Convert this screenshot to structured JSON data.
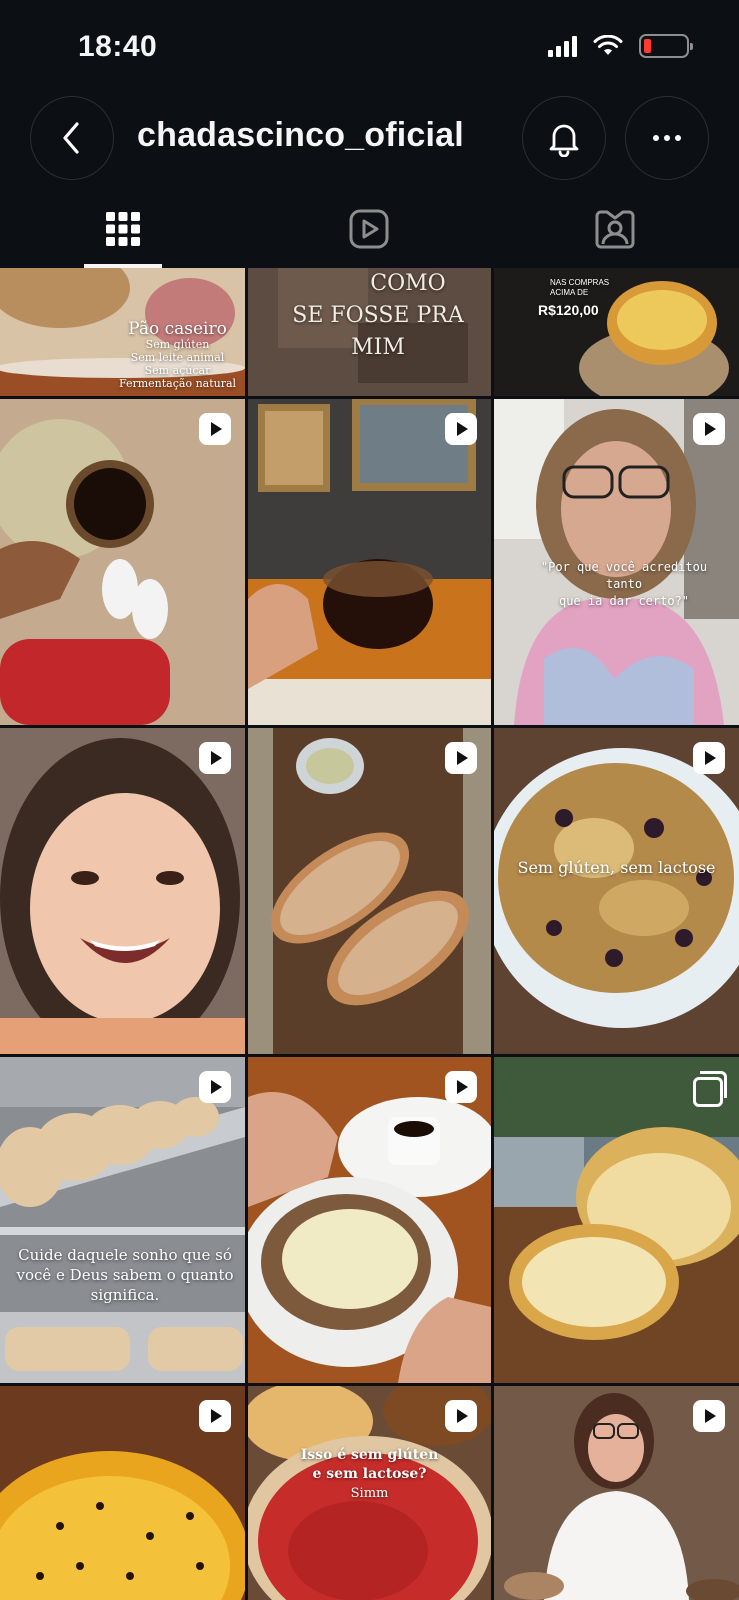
{
  "status_bar": {
    "time": "18:40"
  },
  "header": {
    "username": "chadascinco_oficial"
  },
  "tabs": [
    {
      "name": "grid",
      "active": true
    },
    {
      "name": "reels",
      "active": false
    },
    {
      "name": "tagged",
      "active": false
    }
  ],
  "posts": [
    {
      "type": "image",
      "text_lines": [
        "Pão caseiro",
        "Sem glúten",
        "Sem leite animal",
        "Sem açúcar",
        "Fermentação natural"
      ]
    },
    {
      "type": "image",
      "text_lines": [
        "COMO",
        "SE FOSSE PRA MIM"
      ]
    },
    {
      "type": "image",
      "text_lines": [
        "NAS COMPRAS ACIMA DE",
        "R$120,00"
      ]
    },
    {
      "type": "reel",
      "text_lines": []
    },
    {
      "type": "reel",
      "text_lines": []
    },
    {
      "type": "reel",
      "text_lines": [
        "\"Por que você acreditou tanto",
        "que ia dar certo?\""
      ]
    },
    {
      "type": "reel",
      "text_lines": []
    },
    {
      "type": "reel",
      "text_lines": []
    },
    {
      "type": "reel",
      "text_lines": [
        "Sem glúten, sem lactose"
      ]
    },
    {
      "type": "reel",
      "text_lines": [
        "Cuide daquele sonho que só",
        "você e Deus sabem o quanto",
        "significa."
      ]
    },
    {
      "type": "reel",
      "text_lines": []
    },
    {
      "type": "carousel",
      "text_lines": []
    },
    {
      "type": "reel",
      "text_lines": []
    },
    {
      "type": "reel",
      "text_lines": [
        "Isso é sem glúten",
        "e sem lactose?",
        "Simm"
      ]
    },
    {
      "type": "reel",
      "text_lines": []
    }
  ]
}
